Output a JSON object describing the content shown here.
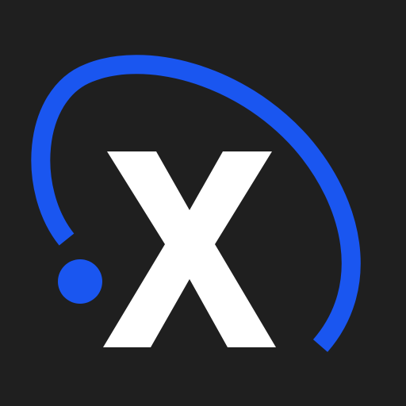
{
  "logo": {
    "name": "x-logo",
    "background_color": "#1f1f1f",
    "letter_color": "#ffffff",
    "accent_color": "#1a56f0",
    "elements": [
      "orbit-arc",
      "dot",
      "letter-x"
    ]
  }
}
